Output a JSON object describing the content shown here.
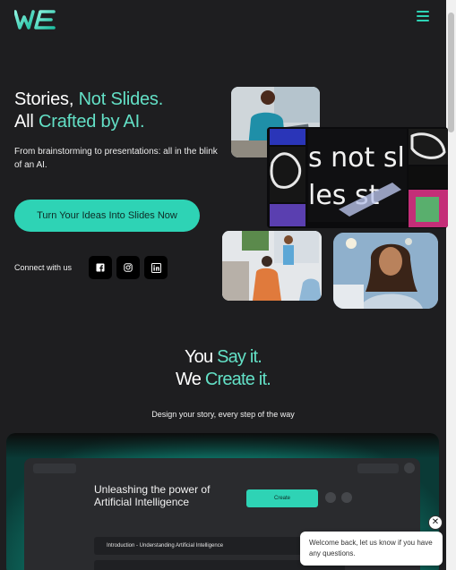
{
  "brand": {
    "logo_text": "WE",
    "accent": "#2ed3b5"
  },
  "header": {
    "menu_icon": "hamburger-icon"
  },
  "hero": {
    "title_line1_a": "Stories, ",
    "title_line1_b": "Not Slides.",
    "title_line2_a": "All ",
    "title_line2_b": "Crafted by AI.",
    "subtitle": "From brainstorming to presentations: all in the blink of an AI.",
    "cta_label": "Turn Your Ideas Into Slides Now",
    "connect_label": "Connect with us",
    "social": [
      {
        "name": "facebook-icon"
      },
      {
        "name": "instagram-icon"
      },
      {
        "name": "linkedin-icon"
      }
    ],
    "collage_text_line1": "s not sl",
    "collage_text_line2": "les st"
  },
  "section": {
    "title_line1_a": "You ",
    "title_line1_b": "Say it.",
    "title_line2_a": "We ",
    "title_line2_b": "Create it.",
    "subtitle": "Design your story, every step of the way"
  },
  "demo": {
    "title": "Unleashing the power of Artificial Intelligence",
    "create_label": "Create",
    "row1": "Introduction - Understanding Artificial Intelligence"
  },
  "chat": {
    "message": "Welcome back, let us know if you have any questions.",
    "close_glyph": "✕"
  }
}
